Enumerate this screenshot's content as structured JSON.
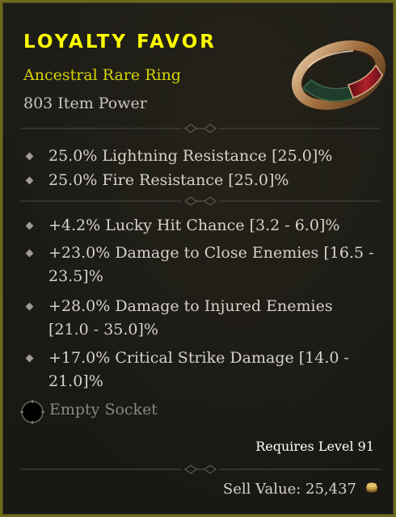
{
  "item": {
    "name": "Loyalty Favor",
    "type": "Ancestral Rare Ring",
    "power": "803 Item Power",
    "icon": "ring-icon"
  },
  "implicit_affixes": [
    "25.0% Lightning Resistance [25.0]%",
    "25.0% Fire Resistance [25.0]%"
  ],
  "affixes": [
    "+4.2% Lucky Hit Chance [3.2 - 6.0]%",
    "+23.0% Damage to Close Enemies [16.5 - 23.5]%",
    "+28.0% Damage to Injured Enemies [21.0 - 35.0]%",
    "+17.0% Critical Strike Damage [14.0 - 21.0]%"
  ],
  "socket": {
    "label": "Empty Socket",
    "icon": "socket-icon"
  },
  "requirements": {
    "level": "Requires Level 91"
  },
  "sell": {
    "label": "Sell Value: 25,437",
    "icon": "gold-icon"
  },
  "colors": {
    "name": "#ffff00",
    "type": "#d7d500",
    "border": "#6d6a1a",
    "text": "#d6d2cc",
    "muted": "#8a8783"
  }
}
